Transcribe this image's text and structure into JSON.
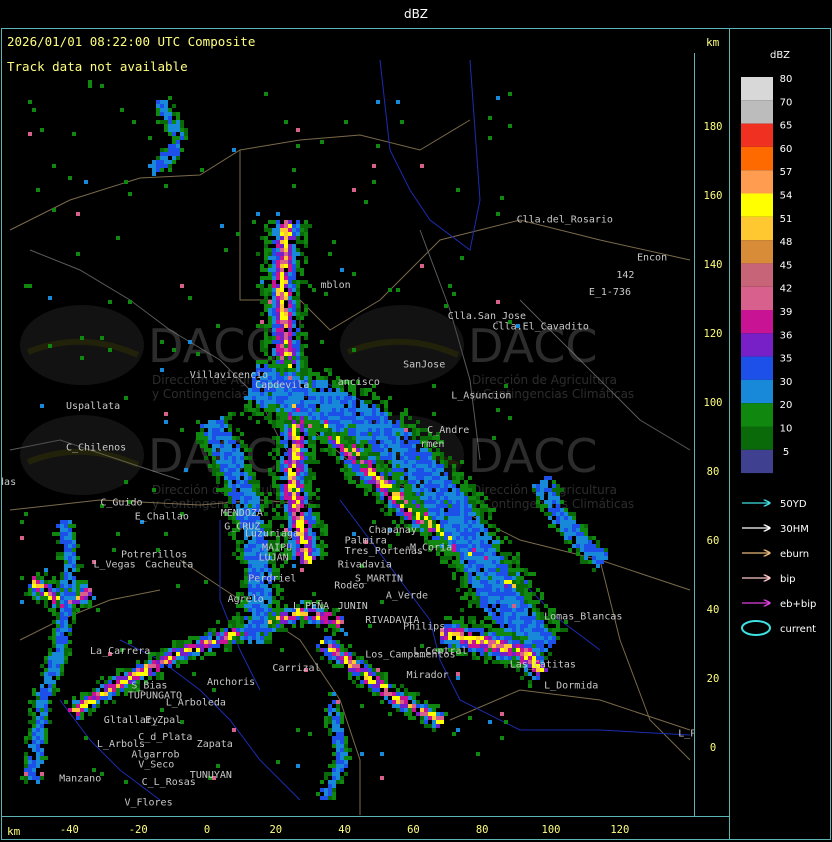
{
  "window_title": "dBZ",
  "header": {
    "timestamp_text": "2026/01/01 08:22:00 UTC Composite",
    "track_notice": "Track data not available",
    "unit_label": "km"
  },
  "axes": {
    "x_label": "km",
    "x_ticks": [
      -40,
      -20,
      0,
      20,
      40,
      60,
      80,
      100,
      120
    ],
    "y_ticks": [
      0,
      20,
      40,
      60,
      80,
      100,
      120,
      140,
      160,
      180
    ]
  },
  "legend": {
    "title": "dBZ",
    "levels": [
      {
        "value": "80",
        "color": "#d8d8d8"
      },
      {
        "value": "70",
        "color": "#bcbcbc"
      },
      {
        "value": "65",
        "color": "#f03020"
      },
      {
        "value": "60",
        "color": "#ff6a00"
      },
      {
        "value": "57",
        "color": "#ff9c50"
      },
      {
        "value": "54",
        "color": "#ffff00"
      },
      {
        "value": "51",
        "color": "#ffc830"
      },
      {
        "value": "48",
        "color": "#d88c38"
      },
      {
        "value": "45",
        "color": "#c86478"
      },
      {
        "value": "42",
        "color": "#d8608c"
      },
      {
        "value": "39",
        "color": "#c81494"
      },
      {
        "value": "36",
        "color": "#7820c8"
      },
      {
        "value": "35",
        "color": "#1c50e8"
      },
      {
        "value": "30",
        "color": "#1888d8"
      },
      {
        "value": "20",
        "color": "#108810"
      },
      {
        "value": "10",
        "color": "#0a6a0a"
      },
      {
        "value": "5",
        "color": "#404090"
      }
    ],
    "tracks": [
      {
        "label": "50YD",
        "color": "#40e0e0"
      },
      {
        "label": "30HM",
        "color": "#ffffff"
      },
      {
        "label": "eburn",
        "color": "#e8b878"
      },
      {
        "label": "bip",
        "color": "#ffc8c8"
      },
      {
        "label": "eb+bip",
        "color": "#e040e0"
      }
    ],
    "current_label": "current",
    "current_color": "#40e0e0"
  },
  "watermark": {
    "brand": "DACC",
    "line1": "Dirección de Agricultura",
    "line2": "y Contingencias Climáticas"
  },
  "places": [
    {
      "name": "Clla.del_Rosario",
      "x": 90,
      "y": 152
    },
    {
      "name": "Encon",
      "x": 125,
      "y": 141
    },
    {
      "name": "142",
      "x": 119,
      "y": 136
    },
    {
      "name": "E_1-736",
      "x": 111,
      "y": 131
    },
    {
      "name": "Clla.San_Jose",
      "x": 70,
      "y": 124
    },
    {
      "name": "Clla.El_Cavadito",
      "x": 83,
      "y": 121
    },
    {
      "name": "mblon",
      "x": 33,
      "y": 133
    },
    {
      "name": "Villavicencio",
      "x": -5,
      "y": 107
    },
    {
      "name": "Uspallata",
      "x": -41,
      "y": 98
    },
    {
      "name": "Capdevila",
      "x": 14,
      "y": 104
    },
    {
      "name": "ancisco",
      "x": 38,
      "y": 105
    },
    {
      "name": "SanJose",
      "x": 57,
      "y": 110
    },
    {
      "name": "L_Asuncion",
      "x": 71,
      "y": 101
    },
    {
      "name": "C_Andre",
      "x": 64,
      "y": 91
    },
    {
      "name": "rmen",
      "x": 62,
      "y": 87
    },
    {
      "name": "C_Chilenos",
      "x": -41,
      "y": 86
    },
    {
      "name": "aredas",
      "x": -66,
      "y": 76
    },
    {
      "name": "C_Guido",
      "x": -31,
      "y": 70
    },
    {
      "name": "E_Challao",
      "x": -21,
      "y": 66
    },
    {
      "name": "MENDOZA",
      "x": 4,
      "y": 67
    },
    {
      "name": "G_CRUZ",
      "x": 5,
      "y": 63
    },
    {
      "name": "Luzuriaga",
      "x": 11,
      "y": 61
    },
    {
      "name": "Chapanay",
      "x": 47,
      "y": 62
    },
    {
      "name": "Palmira",
      "x": 40,
      "y": 59
    },
    {
      "name": "Tres_Porteñas",
      "x": 40,
      "y": 56
    },
    {
      "name": "M_Coria",
      "x": 59,
      "y": 57
    },
    {
      "name": "Potrerillos",
      "x": -25,
      "y": 55
    },
    {
      "name": "L_Vegas",
      "x": -33,
      "y": 52
    },
    {
      "name": "Cacheuta",
      "x": -18,
      "y": 52
    },
    {
      "name": "MAIPU",
      "x": 16,
      "y": 57
    },
    {
      "name": "LUJAN",
      "x": 15,
      "y": 54
    },
    {
      "name": "Perdriel",
      "x": 12,
      "y": 48
    },
    {
      "name": "Rivadavia",
      "x": 38,
      "y": 52
    },
    {
      "name": "S_MARTIN",
      "x": 43,
      "y": 48
    },
    {
      "name": "A_Verde",
      "x": 52,
      "y": 43
    },
    {
      "name": "Rodeo",
      "x": 37,
      "y": 46
    },
    {
      "name": "Agrelo",
      "x": 6,
      "y": 42
    },
    {
      "name": "L_PEÑA",
      "x": 25,
      "y": 40
    },
    {
      "name": "JUNIN",
      "x": 38,
      "y": 40
    },
    {
      "name": "Philips",
      "x": 57,
      "y": 34
    },
    {
      "name": "RIVADAVIA",
      "x": 46,
      "y": 36
    },
    {
      "name": "Lomas_Blancas",
      "x": 98,
      "y": 37
    },
    {
      "name": "La_Carrera",
      "x": -34,
      "y": 27
    },
    {
      "name": "Carrizal",
      "x": 19,
      "y": 22
    },
    {
      "name": "Los_Campamentos",
      "x": 46,
      "y": 26
    },
    {
      "name": "L_Central",
      "x": 60,
      "y": 27
    },
    {
      "name": "Mirador",
      "x": 58,
      "y": 20
    },
    {
      "name": "Las_Catitas",
      "x": 88,
      "y": 23
    },
    {
      "name": "L_Dormida",
      "x": 98,
      "y": 17
    },
    {
      "name": "S_Bias",
      "x": -22,
      "y": 17
    },
    {
      "name": "TUPUNGATO",
      "x": -23,
      "y": 14
    },
    {
      "name": "Anchoris",
      "x": 0,
      "y": 18
    },
    {
      "name": "L_Arboleda",
      "x": -12,
      "y": 12
    },
    {
      "name": "Gltallary",
      "x": -30,
      "y": 7
    },
    {
      "name": "E_Zpal",
      "x": -18,
      "y": 7
    },
    {
      "name": "C_d_Plata",
      "x": -20,
      "y": 2
    },
    {
      "name": "L_Arbols",
      "x": -32,
      "y": 0
    },
    {
      "name": "Zapata",
      "x": -3,
      "y": 0
    },
    {
      "name": "Algarrob",
      "x": -22,
      "y": -3
    },
    {
      "name": "V_Seco",
      "x": -20,
      "y": -6
    },
    {
      "name": "TUNUYAN",
      "x": -5,
      "y": -9
    },
    {
      "name": "Manzano",
      "x": -43,
      "y": -10
    },
    {
      "name": "C_L_Rosas",
      "x": -19,
      "y": -11
    },
    {
      "name": "V_Flores",
      "x": -24,
      "y": -17
    },
    {
      "name": "L_PAZ",
      "x": 137,
      "y": 3
    }
  ]
}
